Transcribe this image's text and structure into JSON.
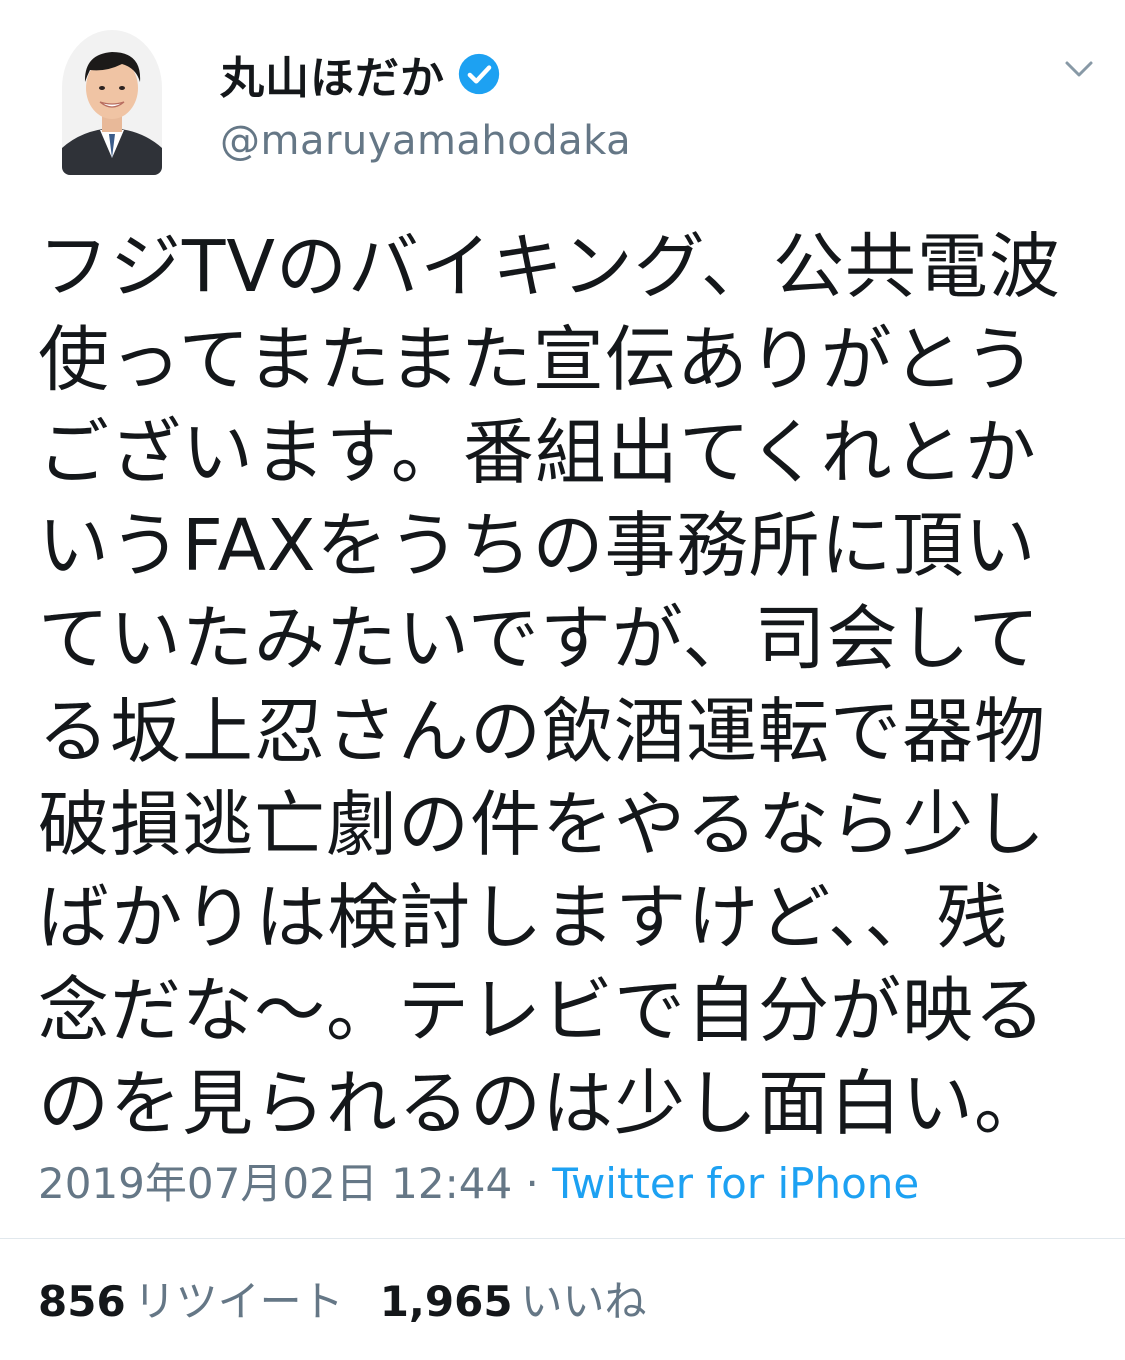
{
  "user": {
    "display_name": "丸山ほだか",
    "handle": "@maruyamahodaka",
    "verified": true,
    "verified_color": "#1da1f2"
  },
  "tweet": {
    "lines": [
      "フジTVのバイキング、公共電波",
      "使ってまたまた宣伝ありがとう",
      "ございます。番組出てくれとか",
      "いうFAXをうちの事務所に頂い",
      "ていたみたいですが、司会して",
      "る坂上忍さんの飲酒運転で器物",
      "破損逃亡劇の件をやるなら少し",
      "ばかりは検討しますけど、、残",
      "念だな〜。テレビで自分が映る",
      "のを見られるのは少し面白い。"
    ]
  },
  "meta": {
    "timestamp": "2019年07月02日 12:44",
    "separator": " · ",
    "source": "Twitter for iPhone"
  },
  "stats": {
    "retweets_count": "856",
    "retweets_label": "リツイート",
    "likes_count": "1,965",
    "likes_label": "いいね"
  },
  "icons": {
    "verified": "verified-badge-icon",
    "caret": "chevron-down-icon",
    "avatar": "profile-avatar"
  },
  "colors": {
    "text": "#14171a",
    "secondary": "#657786",
    "link": "#1da1f2",
    "divider": "#e1e8ed"
  }
}
